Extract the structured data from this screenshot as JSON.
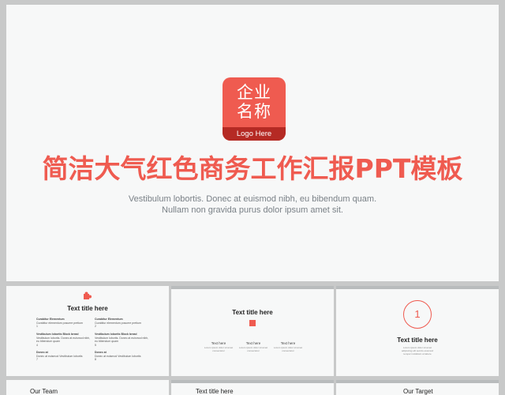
{
  "main": {
    "logo_line1": "企业",
    "logo_line2": "名称",
    "logo_strip": "Logo Here",
    "title": "简洁大气红色商务工作汇报PPT模板",
    "subtitle_line1": "Vestibulum lobortis. Donec at euismod nibh, eu bibendum quam.",
    "subtitle_line2": "Nullam non gravida purus dolor ipsum amet sit."
  },
  "thumb1": {
    "title": "Text title here",
    "items": [
      {
        "h": "Curabitur Elementum",
        "t": "Curabitur elementum posuere pretium",
        "n": "1"
      },
      {
        "h": "Curabitur Elementum",
        "t": "Curabitur elementum posuere pretium",
        "n": "2"
      },
      {
        "h": "Vestibulum lobortis Block bread",
        "t": "Vestibulum lobortis. Donec at euismod nibh, eu bibendum quam",
        "n": "4"
      },
      {
        "h": "Vestibulum lobortis Block bread",
        "t": "Vestibulum lobortis. Donec at euismod nibh, eu bibendum quam",
        "n": "5"
      },
      {
        "h": "Donec at",
        "t": "Donec at euismod Vestibulum lobortis",
        "n": "7"
      },
      {
        "h": "Donec at",
        "t": "Donec at euismod Vestibulum lobortis",
        "n": "8"
      }
    ]
  },
  "thumb2": {
    "title": "Text title here",
    "cols": [
      {
        "label": "Text here",
        "text": "Lorem ipsum dolor sit amet consectetur"
      },
      {
        "label": "Text here",
        "text": "Lorem ipsum dolor sit amet consectetur"
      },
      {
        "label": "Text here",
        "text": "Lorem ipsum dolor sit amet consectetur"
      }
    ]
  },
  "thumb3": {
    "number": "1",
    "title": "Text title here",
    "lines": [
      "Lorem ipsum dolor sit amet",
      "adipiscing elit sed do eiusmod",
      "tempor incididunt ut labore"
    ]
  },
  "bottom": {
    "left": "Our Team",
    "mid": "Text title here",
    "right": "Our Target"
  },
  "colors": {
    "accent": "#ef5b50",
    "accent_dark": "#b52a24",
    "slide_bg": "#f7f8f8",
    "frame_bg": "#c8c9c9"
  }
}
